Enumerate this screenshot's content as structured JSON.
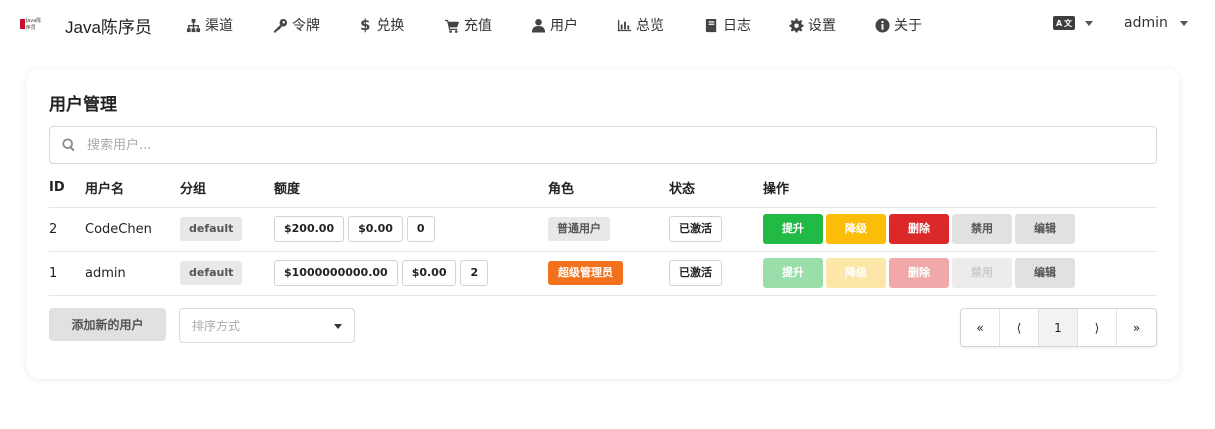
{
  "header": {
    "logo_text": "Java陈序员",
    "brand": "Java陈序员",
    "nav": [
      {
        "label": "渠道",
        "icon": "sitemap-icon"
      },
      {
        "label": "令牌",
        "icon": "key-icon"
      },
      {
        "label": "兑换",
        "icon": "dollar-icon"
      },
      {
        "label": "充值",
        "icon": "cart-icon"
      },
      {
        "label": "用户",
        "icon": "user-icon"
      },
      {
        "label": "总览",
        "icon": "chart-icon"
      },
      {
        "label": "日志",
        "icon": "book-icon"
      },
      {
        "label": "设置",
        "icon": "gear-icon"
      },
      {
        "label": "关于",
        "icon": "info-icon"
      }
    ],
    "lang_icon": "language-icon",
    "user": "admin"
  },
  "main": {
    "title": "用户管理",
    "search_placeholder": "搜索用户...",
    "columns": [
      "ID",
      "用户名",
      "分组",
      "额度",
      "角色",
      "状态",
      "操作"
    ],
    "rows": [
      {
        "id": "2",
        "username": "CodeChen",
        "group": "default",
        "quota": [
          "$200.00",
          "$0.00",
          "0"
        ],
        "role": "普通用户",
        "status": "已激活",
        "actions": [
          "提升",
          "降级",
          "删除",
          "禁用",
          "编辑"
        ]
      },
      {
        "id": "1",
        "username": "admin",
        "group": "default",
        "quota": [
          "$1000000000.00",
          "$0.00",
          "2"
        ],
        "role": "超级管理员",
        "status": "已激活",
        "actions": [
          "提升",
          "降级",
          "删除",
          "禁用",
          "编辑"
        ]
      }
    ],
    "add_button": "添加新的用户",
    "sort_placeholder": "排序方式",
    "pagination": [
      "«",
      "⟨",
      "1",
      "⟩",
      "»"
    ]
  },
  "colors": {
    "promote": "#21ba45",
    "demote": "#fbbd08",
    "delete": "#db2828",
    "super_admin_badge": "#f2711c"
  }
}
